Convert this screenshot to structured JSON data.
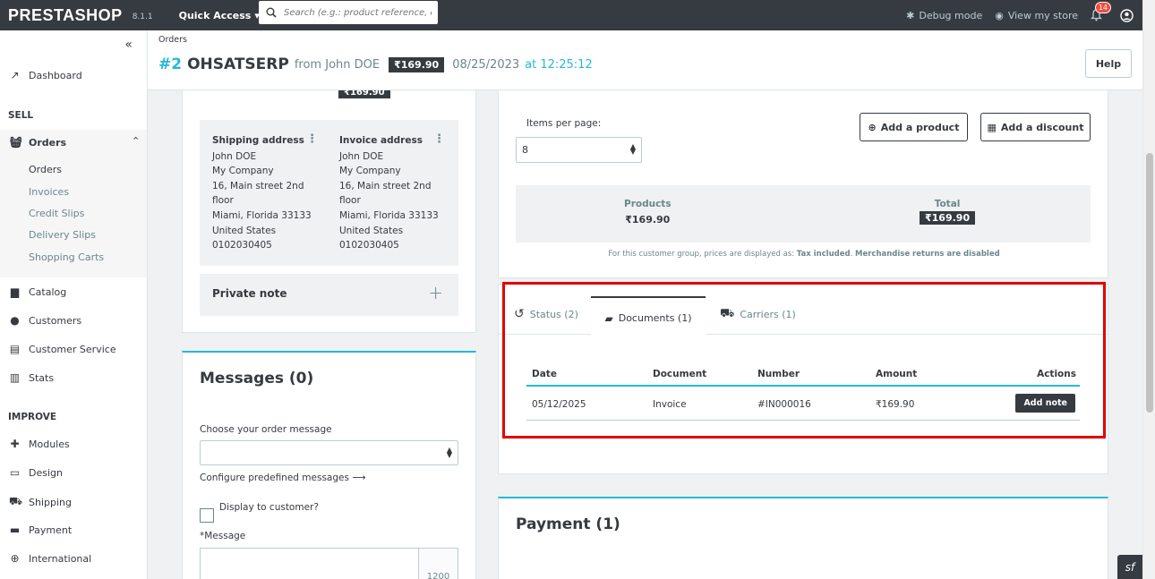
{
  "topbar": {
    "logo": "PRESTASHOP",
    "version": "8.1.1",
    "quick_access": "Quick Access",
    "search_placeholder": "Search (e.g.: product reference, custo",
    "debug_mode": "Debug mode",
    "view_store": "View my store",
    "notifications_count": "14"
  },
  "sidebar": {
    "dashboard": "Dashboard",
    "sell_title": "SELL",
    "orders": "Orders",
    "orders_sub": [
      "Orders",
      "Invoices",
      "Credit Slips",
      "Delivery Slips",
      "Shopping Carts"
    ],
    "catalog": "Catalog",
    "customers": "Customers",
    "customer_service": "Customer Service",
    "stats": "Stats",
    "improve_title": "IMPROVE",
    "modules": "Modules",
    "design": "Design",
    "shipping": "Shipping",
    "payment": "Payment",
    "international": "International"
  },
  "header": {
    "breadcrumb": "Orders",
    "order_num": "#2",
    "reference": "OHSATSERP",
    "from": "from John DOE",
    "total": "₹169.90",
    "date": "08/25/2023",
    "at": "at 12:25:12",
    "help": "Help"
  },
  "customer": {
    "top_price": "₹169.90",
    "shipping": {
      "title": "Shipping address",
      "lines": [
        "John DOE",
        "My Company",
        "16, Main street 2nd",
        "floor",
        "Miami, Florida 33133",
        "United States",
        "0102030405"
      ]
    },
    "invoice": {
      "title": "Invoice address",
      "lines": [
        "John DOE",
        "My Company",
        "16, Main street 2nd",
        "floor",
        "Miami, Florida 33133",
        "United States",
        "0102030405"
      ]
    },
    "private_note": "Private note"
  },
  "messages": {
    "title": "Messages (0)",
    "choose_label": "Choose your order message",
    "configure_link": "Configure predefined messages",
    "display_to_customer": "Display to customer?",
    "message_label_star": "*",
    "message_label": "Message",
    "counter": "1200"
  },
  "products": {
    "items_per_page_label": "Items per page:",
    "items_per_page_value": "8",
    "add_product": "Add a product",
    "add_discount": "Add a discount",
    "products_label": "Products",
    "products_value": "₹169.90",
    "total_label": "Total",
    "total_value": "₹169.90",
    "note_prefix": "For this customer group, prices are displayed as: ",
    "note_tax": "Tax included",
    "note_sep": ". ",
    "note_returns": "Merchandise returns are disabled"
  },
  "tabs": {
    "status": "Status (2)",
    "documents": "Documents (1)",
    "carriers": "Carriers (1)"
  },
  "documents": {
    "headers": {
      "date": "Date",
      "document": "Document",
      "number": "Number",
      "amount": "Amount",
      "actions": "Actions"
    },
    "rows": [
      {
        "date": "05/12/2025",
        "document": "Invoice",
        "number": "#IN000016",
        "amount": "₹169.90",
        "action": "Add note"
      }
    ]
  },
  "payment": {
    "title": "Payment (1)"
  },
  "colors": {
    "accent": "#25b9d7",
    "dark": "#363a41",
    "highlight": "#e20000"
  }
}
